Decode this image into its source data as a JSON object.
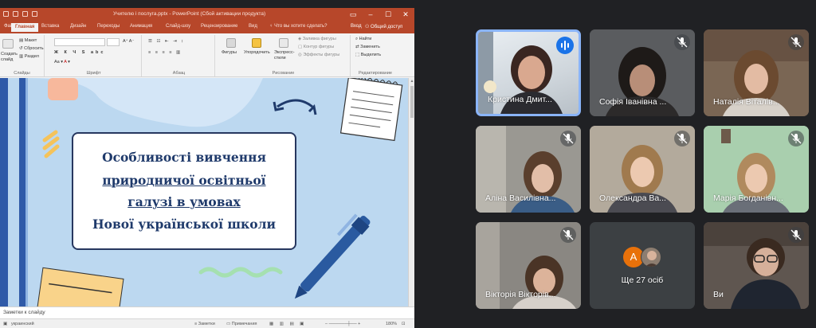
{
  "powerpoint": {
    "window_title": "Учителю і послуга.pptx - PowerPoint (Сбой активации продукта)",
    "tabs": [
      "Файл",
      "Главная",
      "Вставка",
      "Дизайн",
      "Переходы",
      "Анимация",
      "Слайд-шоу",
      "Рецензирование",
      "Вид"
    ],
    "active_tab_index": 1,
    "tell_me": "Что вы хотите сделать?",
    "sign_in": "Вход",
    "share": "Общий доступ",
    "ribbon": {
      "create_slide": "Создать слайд",
      "layout": "Макет",
      "reset": "Сбросить",
      "section": "Раздел",
      "group_slides": "Слайды",
      "group_font": "Шрифт",
      "group_paragraph": "Абзац",
      "shapes": "Фигуры",
      "arrange": "Упорядочить",
      "quick_styles": "Экспресс-стили",
      "fill": "Заливка фигуры",
      "outline": "Контур фигуры",
      "effects": "Эффекты фигуры",
      "group_drawing": "Рисование",
      "find": "Найти",
      "replace": "Заменить",
      "select": "Выделить",
      "group_editing": "Редактирование"
    },
    "slide": {
      "title_lines": [
        "Особливості вивчення",
        "природничої освітньої",
        "галузі  в умовах",
        "Нової української школи"
      ]
    },
    "notes_placeholder": "Заметки к слайду",
    "status": {
      "language": "украинский",
      "notes": "Заметки",
      "comments": "Примечания",
      "zoom": "180%"
    }
  },
  "meet": {
    "participants": [
      {
        "name": "Кристина Дмит...",
        "speaking": true
      },
      {
        "name": "Софія Іванівна ...",
        "muted": true
      },
      {
        "name": "Наталія Віталів...",
        "muted": true
      },
      {
        "name": "Аліна Василівна...",
        "muted": true
      },
      {
        "name": "Олександра Ва...",
        "muted": true
      },
      {
        "name": "Марія Богданівн...",
        "muted": true
      },
      {
        "name": "Вікторія Вікторів...",
        "muted": true
      },
      {
        "name": "Ще 27 осіб",
        "more_avatar_letter": "А"
      },
      {
        "name": "Ви",
        "muted": true
      }
    ],
    "colors": {
      "speaking": "#1a73e8",
      "active_border": "#8ab4f8",
      "avatar_a": "#e8710a"
    }
  }
}
